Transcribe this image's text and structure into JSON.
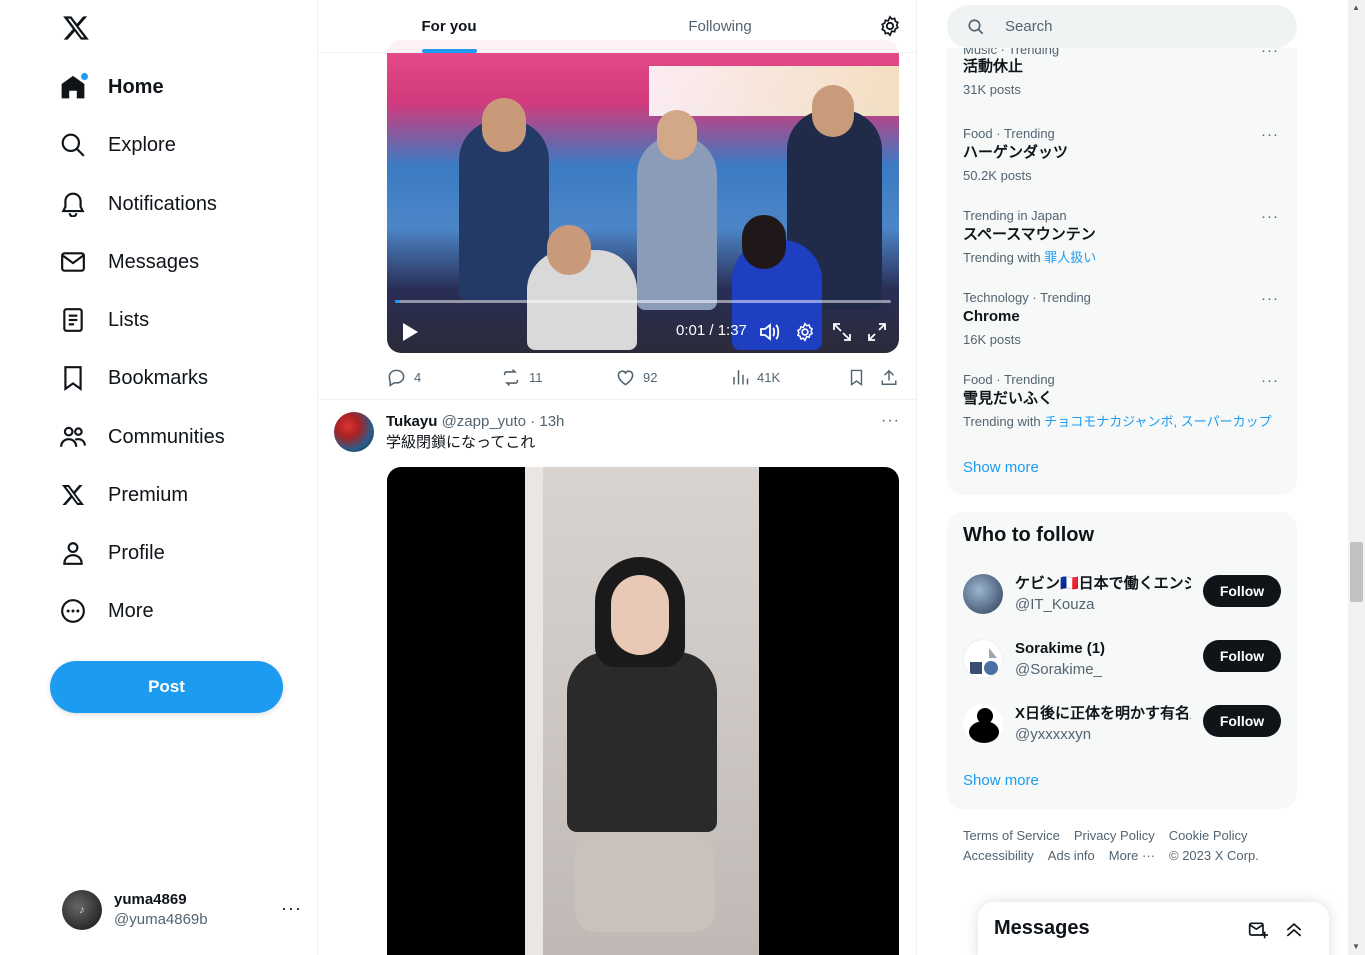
{
  "nav": {
    "items": [
      {
        "label": "Home",
        "icon": "home-icon"
      },
      {
        "label": "Explore",
        "icon": "search-icon"
      },
      {
        "label": "Notifications",
        "icon": "bell-icon"
      },
      {
        "label": "Messages",
        "icon": "mail-icon"
      },
      {
        "label": "Lists",
        "icon": "list-icon"
      },
      {
        "label": "Bookmarks",
        "icon": "bookmark-icon"
      },
      {
        "label": "Communities",
        "icon": "people-icon"
      },
      {
        "label": "Premium",
        "icon": "x-logo-icon"
      },
      {
        "label": "Profile",
        "icon": "person-icon"
      },
      {
        "label": "More",
        "icon": "more-circle-icon"
      }
    ],
    "post_label": "Post"
  },
  "account": {
    "name": "yuma4869",
    "handle": "@yuma4869b",
    "more": "···"
  },
  "tabs": {
    "for_you": "For you",
    "following": "Following"
  },
  "tweet1": {
    "time": "0:01 / 1:37",
    "progress": 0.01,
    "replies": "4",
    "reposts": "11",
    "likes": "92",
    "views": "41K"
  },
  "tweet2": {
    "name": "Tukayu",
    "handle": "@zapp_yuto",
    "time": "13h",
    "text": "学級閉鎖になってこれ"
  },
  "search": {
    "placeholder": "Search"
  },
  "trends": [
    {
      "category": "Music · Trending",
      "name": "活動休止",
      "count": "31K posts"
    },
    {
      "category": "Food · Trending",
      "name": "ハーゲンダッツ",
      "count": "50.2K posts"
    },
    {
      "category": "Trending in Japan",
      "name": "スペースマウンテン",
      "count_prefix": "Trending with",
      "links": [
        "罪人扱い"
      ]
    },
    {
      "category": "Technology · Trending",
      "name": "Chrome",
      "count": "16K posts"
    },
    {
      "category": "Food · Trending",
      "name": "雪見だいふく",
      "count_prefix": "Trending with",
      "links": [
        "チョコモナカジャンボ",
        "スーパーカップ"
      ]
    }
  ],
  "trends_show_more": "Show more",
  "who_to_follow": {
    "title": "Who to follow",
    "users": [
      {
        "name": "ケビン🇫🇷日本で働くエンジニア",
        "handle": "@IT_Kouza",
        "button": "Follow"
      },
      {
        "name": "Sorakime (1)",
        "handle": "@Sorakime_",
        "button": "Follow"
      },
      {
        "name": "X日後に正体を明かす有名人",
        "handle": "@yxxxxxyn",
        "button": "Follow"
      }
    ],
    "show_more": "Show more"
  },
  "footer": {
    "links": [
      "Terms of Service",
      "Privacy Policy",
      "Cookie Policy",
      "Accessibility",
      "Ads info",
      "More ···",
      "© 2023 X Corp."
    ]
  },
  "messages_drawer": {
    "title": "Messages"
  },
  "colors": {
    "accent": "#1d9bf0",
    "text": "#0f1419",
    "muted": "#536471"
  }
}
